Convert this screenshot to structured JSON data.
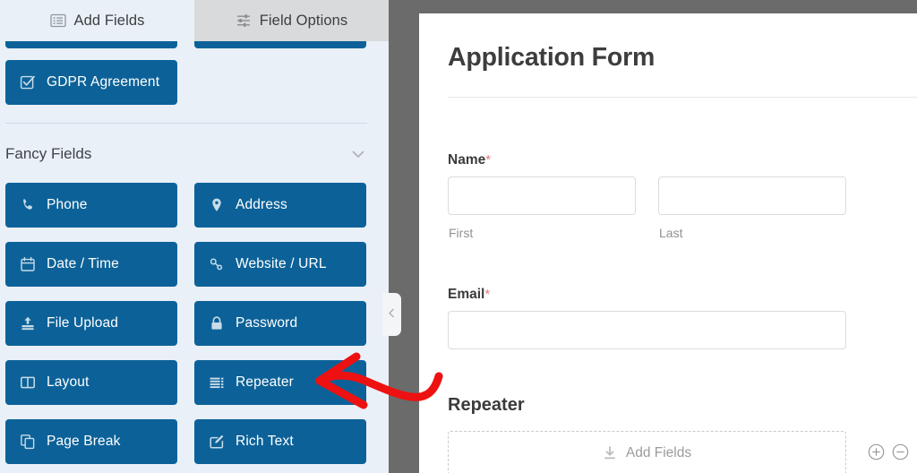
{
  "tabs": [
    {
      "label": "Add Fields",
      "icon": "list-fields-icon",
      "active": true
    },
    {
      "label": "Field Options",
      "icon": "sliders-icon",
      "active": false
    }
  ],
  "sidebar": {
    "partial_buttons": [
      "",
      ""
    ],
    "standard_last_button": {
      "label": "GDPR Agreement",
      "icon": "checkbox-checked-icon"
    },
    "section": {
      "title": "Fancy Fields",
      "chevron": "chevron-down-icon",
      "collapsed": false
    },
    "fields": [
      {
        "label": "Phone",
        "icon": "phone-icon"
      },
      {
        "label": "Address",
        "icon": "map-pin-icon"
      },
      {
        "label": "Date / Time",
        "icon": "calendar-icon"
      },
      {
        "label": "Website / URL",
        "icon": "link-icon"
      },
      {
        "label": "File Upload",
        "icon": "upload-icon"
      },
      {
        "label": "Password",
        "icon": "lock-icon"
      },
      {
        "label": "Layout",
        "icon": "columns-icon"
      },
      {
        "label": "Repeater",
        "icon": "repeater-lines-icon"
      },
      {
        "label": "Page Break",
        "icon": "page-break-icon"
      },
      {
        "label": "Rich Text",
        "icon": "pencil-square-icon"
      }
    ]
  },
  "collapse_handle": {
    "icon": "chevron-left-icon"
  },
  "preview": {
    "form_title": "Application Form",
    "fields": [
      {
        "label": "Name",
        "required_marker": "*",
        "type": "name",
        "subfields": [
          {
            "sublabel": "First",
            "value": ""
          },
          {
            "sublabel": "Last",
            "value": ""
          }
        ]
      },
      {
        "label": "Email",
        "required_marker": "*",
        "type": "email",
        "value": ""
      }
    ],
    "repeater": {
      "title": "Repeater",
      "dropzone_label": "Add Fields",
      "dropzone_icon": "download-arrow-icon",
      "add_button": "plus-circle-icon",
      "remove_button": "minus-circle-icon"
    }
  },
  "annotation": {
    "type": "arrow",
    "color": "#ee1111",
    "points_to": "Repeater"
  },
  "colors": {
    "field_button_blue": "#0c6298",
    "sidebar_bg": "#e9f0f8",
    "tab_inactive_bg": "#d8dadc",
    "preview_bg": "#6b6b6b",
    "required_asterisk": "#e27c81",
    "annotation_red": "#ee1111"
  }
}
